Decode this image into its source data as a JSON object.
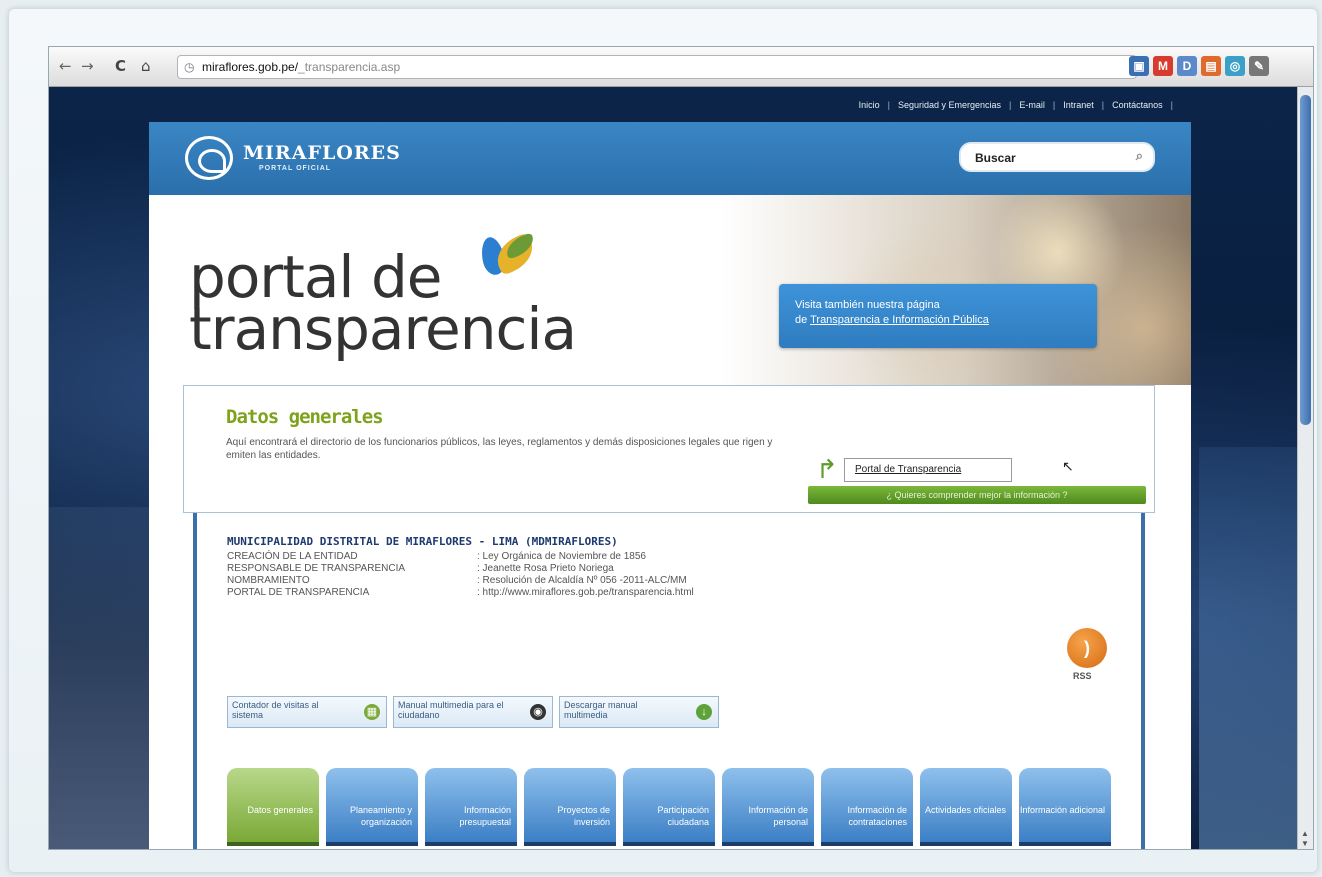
{
  "browser": {
    "url_host": "miraflores.gob.pe/",
    "url_path": "_transparencia.asp",
    "nav": {
      "back": "←",
      "forward": "→",
      "reload": "C",
      "home": "⌂"
    },
    "extensions": [
      {
        "icon": "bookmark-ext-icon",
        "glyph": "▣",
        "color": "#3b6fb4"
      },
      {
        "icon": "gmail-icon",
        "glyph": "M",
        "color": "#d63b2e"
      },
      {
        "icon": "docs-icon",
        "glyph": "D",
        "color": "#5b89c9"
      },
      {
        "icon": "rss-ext-icon",
        "glyph": "▤",
        "color": "#e0692c"
      },
      {
        "icon": "globe-ext-icon",
        "glyph": "◎",
        "color": "#3aa0c8"
      },
      {
        "icon": "wrench-icon",
        "glyph": "✎",
        "color": "#777777"
      }
    ]
  },
  "toplinks": [
    "Inicio",
    "Seguridad y Emergencias",
    "E-mail",
    "Intranet",
    "Contáctanos"
  ],
  "header": {
    "logo": "MIRAFLORES",
    "logo_sub": "PORTAL OFICIAL",
    "search_placeholder": "Buscar"
  },
  "hero": {
    "title_line1": "portal de",
    "title_line2": "transparencia",
    "visit_line1": "Visita también nuestra página",
    "visit_prefix": "de ",
    "visit_link": "Transparencia e Información Pública"
  },
  "datos": {
    "title": "Datos generales",
    "text": "Aquí encontrará el directorio de los funcionarios públicos, las leyes, reglamentos y demás disposiciones legales que rigen y emiten las entidades.",
    "portal_button": "Portal de Transparencia",
    "green_bar": "¿ Quieres comprender mejor la información ?"
  },
  "entity": {
    "title": "MUNICIPALIDAD DISTRITAL DE MIRAFLORES - LIMA (MDMIRAFLORES)",
    "rows": [
      {
        "k": "CREACIÓN DE LA ENTIDAD",
        "v": ": Ley Orgánica de Noviembre de 1856"
      },
      {
        "k": "RESPONSABLE DE TRANSPARENCIA",
        "v": ": Jeanette Rosa Prieto Noriega"
      },
      {
        "k": "NOMBRAMIENTO",
        "v": ": Resolución de Alcaldía Nº 056 -2011-ALC/MM"
      },
      {
        "k": "PORTAL DE TRANSPARENCIA",
        "v": ": http://www.miraflores.gob.pe/transparencia.html"
      }
    ],
    "rss": "RSS"
  },
  "tools": [
    {
      "label": "Contador de visitas al sistema",
      "icon": "counter-icon",
      "glyph": "▦",
      "color": "#7aa937"
    },
    {
      "label": "Manual multimedia para el ciudadano",
      "icon": "disc-icon",
      "glyph": "◉",
      "color": "#333333"
    },
    {
      "label": "Descargar manual multimedia",
      "icon": "download-icon",
      "glyph": "↓",
      "color": "#5ea23a"
    }
  ],
  "tabs": [
    "Datos generales",
    "Planeamiento y organización",
    "Información presupuestal",
    "Proyectos de inversión",
    "Participación ciudadana",
    "Información de personal",
    "Información de contrataciones",
    "Actividades oficiales",
    "Información adicional"
  ]
}
